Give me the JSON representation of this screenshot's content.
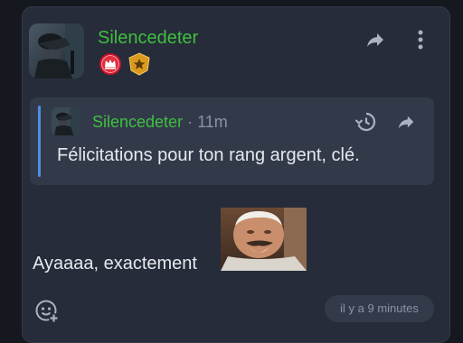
{
  "post": {
    "author": "Silencedeter",
    "badges": [
      "crown-badge",
      "star-badge"
    ],
    "quote": {
      "author": "Silencedeter",
      "separator": "·",
      "time": "11m",
      "text": "Félicitations pour ton rang argent, clé."
    },
    "message": "Ayaaaa, exactement",
    "timestamp": "il y a 9 minutes"
  },
  "colors": {
    "background": "#15181e",
    "card": "#262c39",
    "quote_bg": "#323a4a",
    "username": "#3fbf3f",
    "quote_bar": "#4a90e2",
    "text": "#e6e9ef",
    "muted": "#8a93a6"
  },
  "icons": {
    "share": "share-icon",
    "more": "more-vertical-icon",
    "history": "history-icon",
    "reply_share": "quote-share-icon",
    "add_reaction": "add-reaction-icon"
  }
}
